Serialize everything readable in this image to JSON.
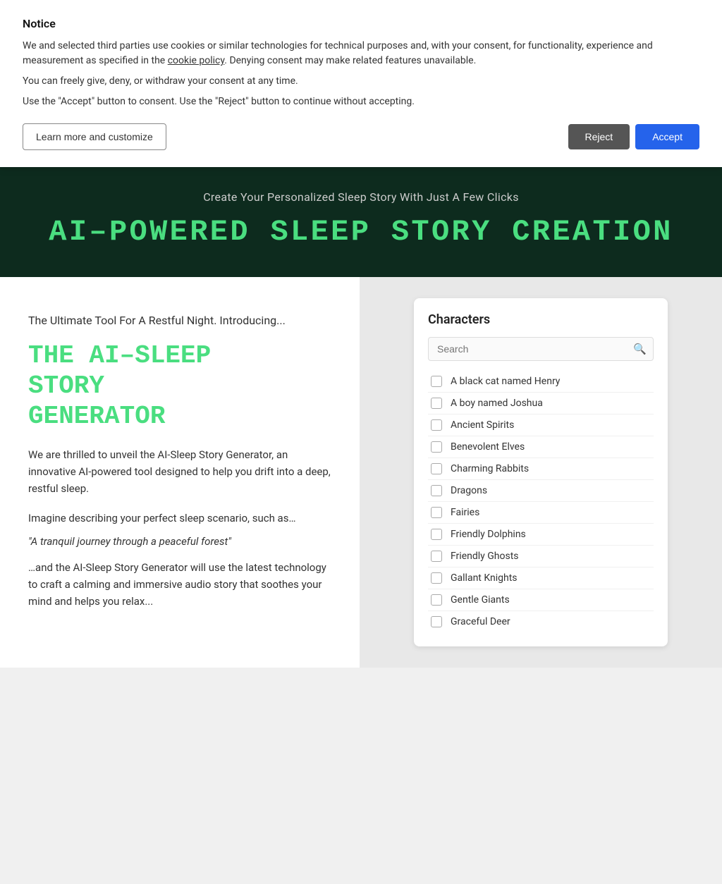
{
  "cookie": {
    "title": "Notice",
    "text1": "We and selected third parties use cookies or similar technologies for technical purposes and, with your consent, for functionality, experience and measurement as specified in the",
    "link_text": "cookie policy",
    "text2": ". Denying consent may make related features unavailable.",
    "text3": "You can freely give, deny, or withdraw your consent at any time.",
    "text4": "Use the \"Accept\" button to consent. Use the \"Reject\" button to continue without accepting.",
    "learn_more_label": "Learn more and customize",
    "reject_label": "Reject",
    "accept_label": "Accept"
  },
  "hero": {
    "subtitle": "Create Your Personalized Sleep Story With Just A Few Clicks",
    "title": "AI–POWERED SLEEP STORY CREATION"
  },
  "left": {
    "intro": "The Ultimate Tool For A Restful Night. Introducing...",
    "title": "THE AI–SLEEP\nSTORY\nGENERATOR",
    "desc1": "We are thrilled to unveil the AI-Sleep Story Generator, an innovative AI-powered tool designed to help you drift into a deep, restful sleep.",
    "desc2": "Imagine describing your perfect sleep scenario, such as…",
    "quote": "\"A tranquil journey through a peaceful forest\"",
    "desc3": "…and the AI-Sleep Story Generator will use the latest technology to craft a calming and immersive audio story that soothes your mind and helps you relax..."
  },
  "characters": {
    "title": "Characters",
    "search_placeholder": "Search",
    "items": [
      "A black cat named Henry",
      "A boy named Joshua",
      "Ancient Spirits",
      "Benevolent Elves",
      "Charming Rabbits",
      "Dragons",
      "Fairies",
      "Friendly Dolphins",
      "Friendly Ghosts",
      "Gallant Knights",
      "Gentle Giants",
      "Graceful Deer"
    ]
  }
}
